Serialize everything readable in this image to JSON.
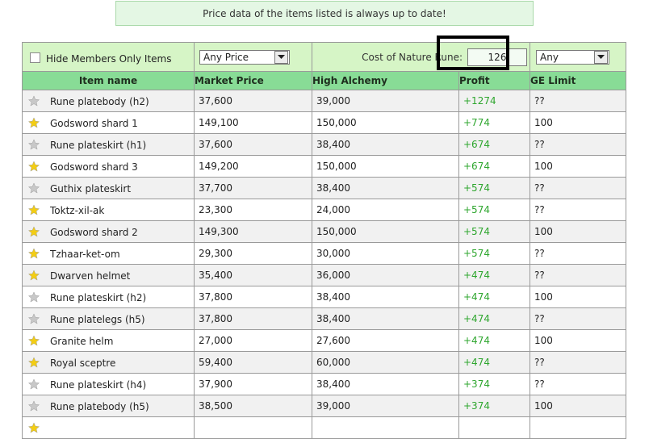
{
  "banner": {
    "text": "Price data of the items listed is always up to date!"
  },
  "filters": {
    "members_checkbox_label": "Hide Members Only Items",
    "members_checked": false,
    "price_select": "Any Price",
    "nature_rune_label": "Cost of Nature Rune:",
    "nature_rune_value": "126",
    "ge_limit_select": "Any"
  },
  "columns": [
    "Item name",
    "Market Price",
    "High Alchemy",
    "Profit",
    "GE Limit"
  ],
  "colors": {
    "star_gold": "#f3cd14",
    "star_gray": "#c8c8c8",
    "profit_green": "#2ea62e",
    "header_green": "#88dc96",
    "filter_green": "#d6f5c6"
  },
  "rows": [
    {
      "star": "gray",
      "name": "Rune platebody (h2)",
      "market": "37,600",
      "alch": "39,000",
      "profit": "+1274",
      "limit": "??"
    },
    {
      "star": "gold",
      "name": "Godsword shard 1",
      "market": "149,100",
      "alch": "150,000",
      "profit": "+774",
      "limit": "100"
    },
    {
      "star": "gray",
      "name": "Rune plateskirt (h1)",
      "market": "37,600",
      "alch": "38,400",
      "profit": "+674",
      "limit": "??"
    },
    {
      "star": "gold",
      "name": "Godsword shard 3",
      "market": "149,200",
      "alch": "150,000",
      "profit": "+674",
      "limit": "100"
    },
    {
      "star": "gray",
      "name": "Guthix plateskirt",
      "market": "37,700",
      "alch": "38,400",
      "profit": "+574",
      "limit": "??"
    },
    {
      "star": "gold",
      "name": "Toktz-xil-ak",
      "market": "23,300",
      "alch": "24,000",
      "profit": "+574",
      "limit": "??"
    },
    {
      "star": "gold",
      "name": "Godsword shard 2",
      "market": "149,300",
      "alch": "150,000",
      "profit": "+574",
      "limit": "100"
    },
    {
      "star": "gold",
      "name": "Tzhaar-ket-om",
      "market": "29,300",
      "alch": "30,000",
      "profit": "+574",
      "limit": "??"
    },
    {
      "star": "gold",
      "name": "Dwarven helmet",
      "market": "35,400",
      "alch": "36,000",
      "profit": "+474",
      "limit": "??"
    },
    {
      "star": "gray",
      "name": "Rune plateskirt (h2)",
      "market": "37,800",
      "alch": "38,400",
      "profit": "+474",
      "limit": "100"
    },
    {
      "star": "gray",
      "name": "Rune platelegs (h5)",
      "market": "37,800",
      "alch": "38,400",
      "profit": "+474",
      "limit": "??"
    },
    {
      "star": "gold",
      "name": "Granite helm",
      "market": "27,000",
      "alch": "27,600",
      "profit": "+474",
      "limit": "100"
    },
    {
      "star": "gold",
      "name": "Royal sceptre",
      "market": "59,400",
      "alch": "60,000",
      "profit": "+474",
      "limit": "??"
    },
    {
      "star": "gray",
      "name": "Rune plateskirt (h4)",
      "market": "37,900",
      "alch": "38,400",
      "profit": "+374",
      "limit": "??"
    },
    {
      "star": "gray",
      "name": "Rune platebody (h5)",
      "market": "38,500",
      "alch": "39,000",
      "profit": "+374",
      "limit": "100"
    },
    {
      "star": "gold",
      "name": "",
      "market": "",
      "alch": "",
      "profit": "",
      "limit": ""
    }
  ]
}
